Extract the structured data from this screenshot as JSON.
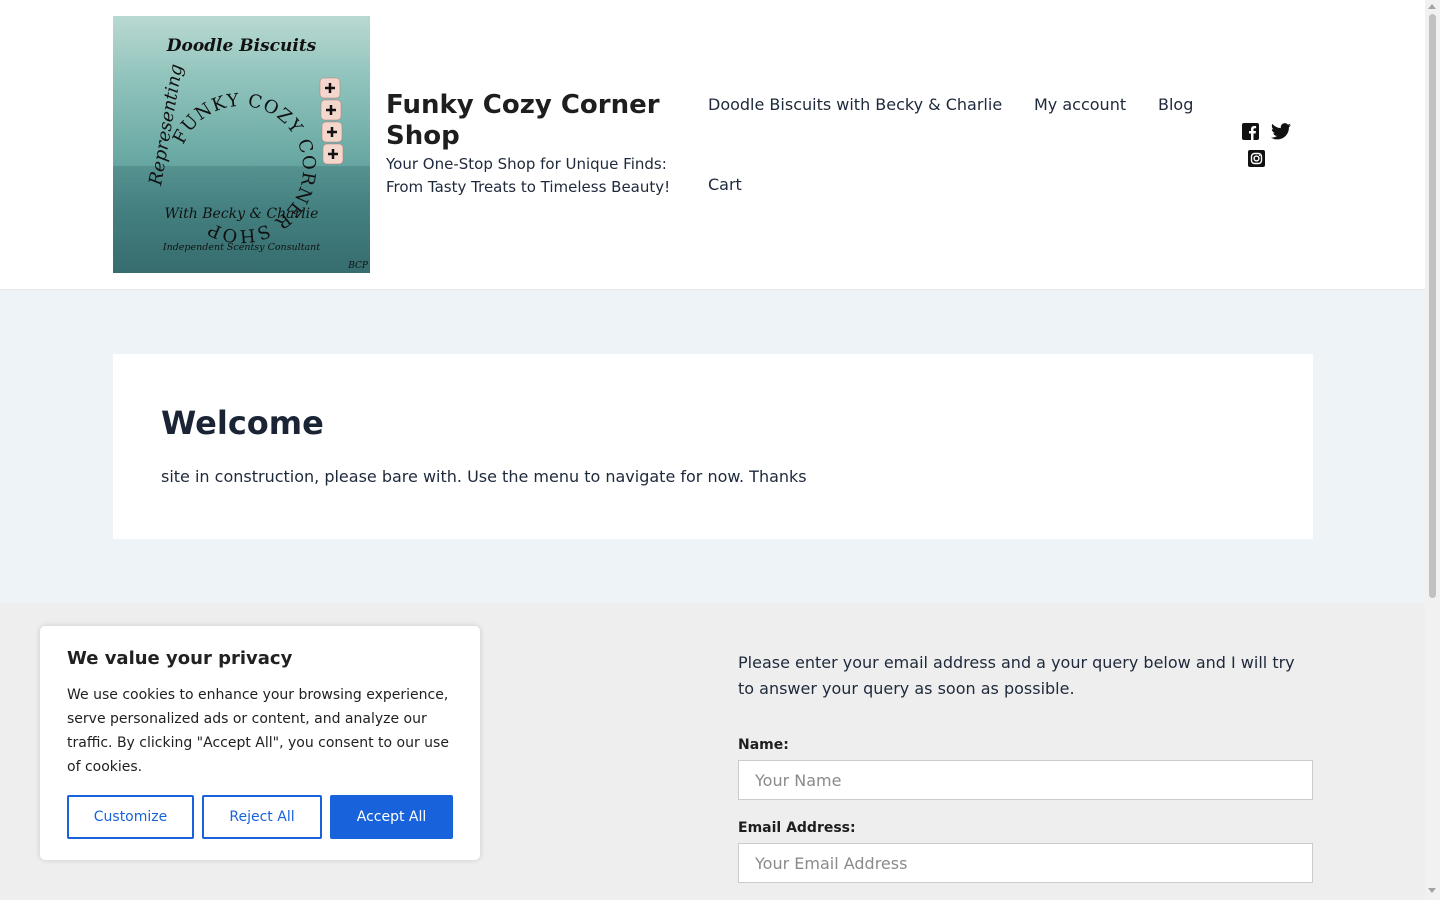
{
  "header": {
    "logo": {
      "top_text": "Doodle Biscuits",
      "ring_text": "FUNKY COZY CORNER SHOP",
      "side_text": "Representing",
      "bottom_text": "With Becky & Charlie",
      "sub_text": "Independent Scentsy Consultant",
      "initials": "BCP"
    },
    "site_title": "Funky Cozy Corner Shop",
    "tagline": "Your One-Stop Shop for Unique Finds: From Tasty Treats to Timeless Beauty!",
    "nav": [
      {
        "label": "Doodle Biscuits with Becky & Charlie"
      },
      {
        "label": "My account"
      },
      {
        "label": "Blog"
      },
      {
        "label": "Cart"
      }
    ],
    "social_icons": [
      "facebook-icon",
      "twitter-icon",
      "instagram-icon"
    ]
  },
  "main": {
    "heading": "Welcome",
    "body": "site in construction, please bare with. Use the menu to navigate for now. Thanks"
  },
  "contact": {
    "intro": "Please enter your email address and a your query below and I will try to answer your query as soon as possible.",
    "name_label": "Name:",
    "name_placeholder": "Your Name",
    "email_label": "Email Address:",
    "email_placeholder": "Your Email Address"
  },
  "cookie_banner": {
    "title": "We value your privacy",
    "text": "We use cookies to enhance your browsing experience, serve personalized ads or content, and analyze our traffic. By clicking \"Accept All\", you consent to our use of cookies.",
    "customize_label": "Customize",
    "reject_label": "Reject All",
    "accept_label": "Accept All"
  },
  "colors": {
    "accent": "#1863dc",
    "content_bg": "#eef3f7",
    "footer_bg": "#eeeeee",
    "text": "#1e293b"
  }
}
